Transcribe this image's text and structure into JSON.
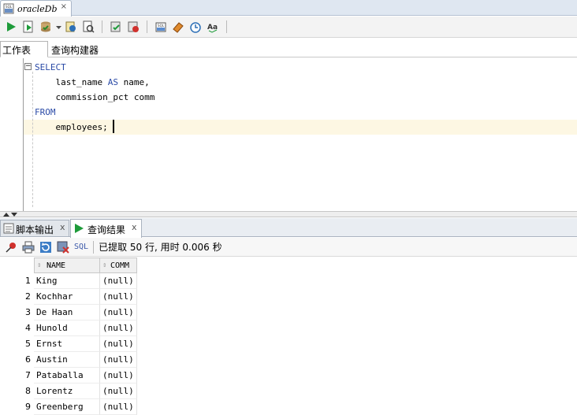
{
  "doc_tab": {
    "title": "oracleDb",
    "close": "×"
  },
  "subtabs": {
    "worksheet": "工作表",
    "query_builder": "查询构建器"
  },
  "editor": {
    "lines": [
      {
        "keyword": "SELECT",
        "text": ""
      },
      {
        "keyword": "",
        "text": "    last_name ",
        "kw2": "AS",
        "text2": " name,"
      },
      {
        "keyword": "",
        "text": "    commission_pct comm"
      },
      {
        "keyword": "FROM",
        "text": ""
      },
      {
        "keyword": "",
        "text": "    employees;"
      }
    ],
    "fold_glyph": "−"
  },
  "bottom_tabs": {
    "script_output": "脚本输出",
    "query_result": "查询结果",
    "close": "x"
  },
  "result_toolbar": {
    "sql_label": "SQL",
    "status": "已提取 50 行, 用时 0.006 秒"
  },
  "grid": {
    "columns": [
      "NAME",
      "COMM"
    ],
    "rows": [
      {
        "n": "1",
        "name": "King",
        "comm": "(null)"
      },
      {
        "n": "2",
        "name": "Kochhar",
        "comm": "(null)"
      },
      {
        "n": "3",
        "name": "De Haan",
        "comm": "(null)"
      },
      {
        "n": "4",
        "name": "Hunold",
        "comm": "(null)"
      },
      {
        "n": "5",
        "name": "Ernst",
        "comm": "(null)"
      },
      {
        "n": "6",
        "name": "Austin",
        "comm": "(null)"
      },
      {
        "n": "7",
        "name": "Pataballa",
        "comm": "(null)"
      },
      {
        "n": "8",
        "name": "Lorentz",
        "comm": "(null)"
      },
      {
        "n": "9",
        "name": "Greenberg",
        "comm": "(null)"
      }
    ]
  },
  "colors": {
    "keyword": "#2a4aa6",
    "run_green": "#1e9b3a",
    "current_line": "#fdf7e3"
  }
}
